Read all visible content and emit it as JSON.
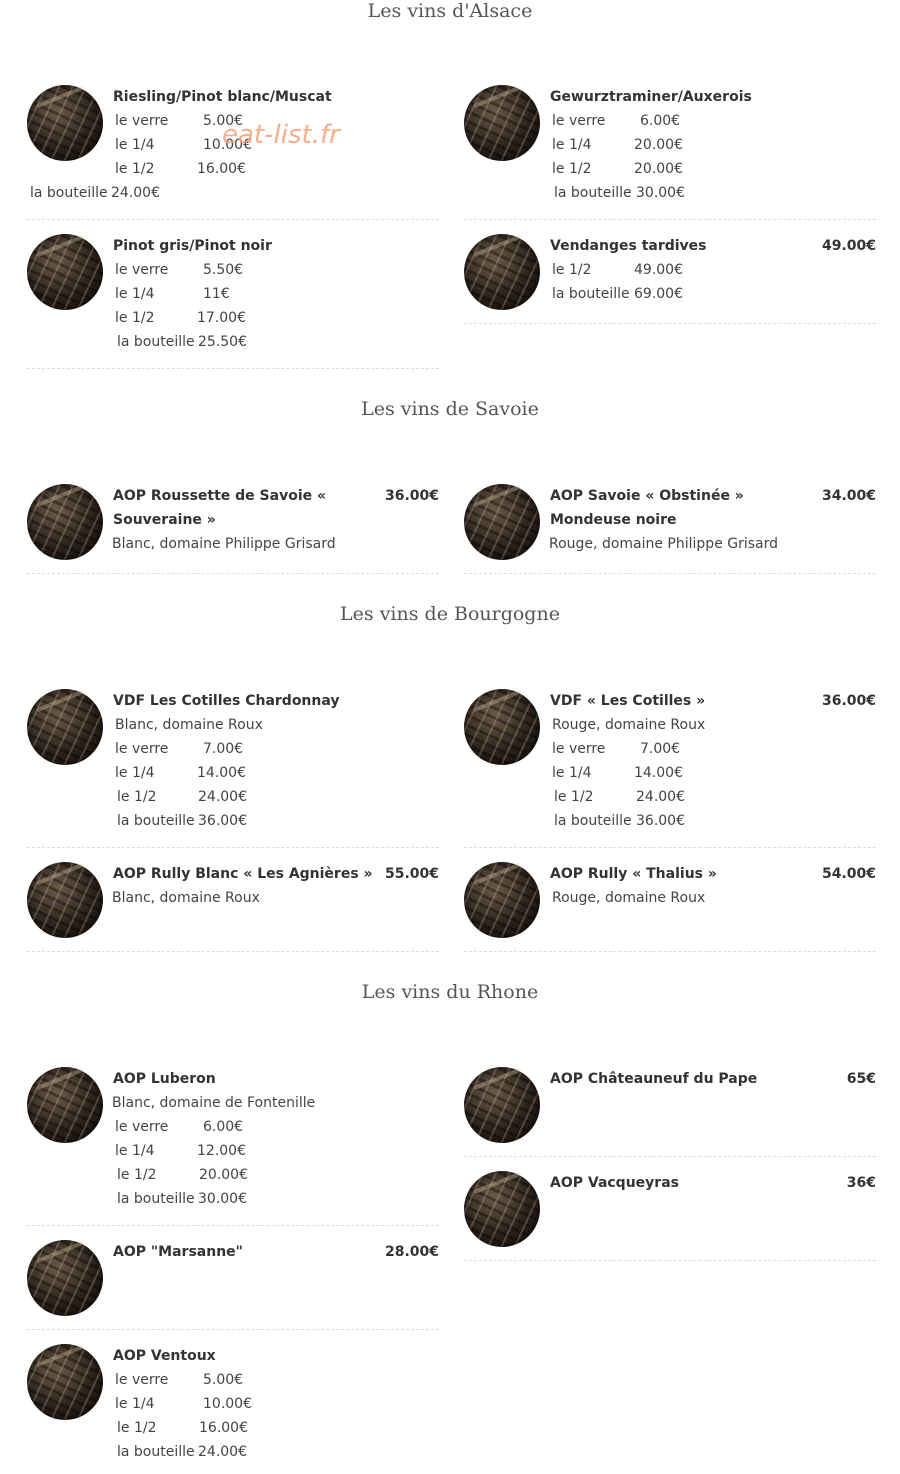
{
  "watermark": "eat-list.fr",
  "sections": [
    {
      "title": "Les vins d'Alsace"
    },
    {
      "title": "Les vins de Savoie"
    },
    {
      "title": "Les vins de Bourgogne"
    },
    {
      "title": "Les vins du Rhone"
    }
  ],
  "items": {
    "riesling": {
      "name": "Riesling/Pinot blanc/Muscat",
      "rows": [
        [
          "le verre",
          "5.00€"
        ],
        [
          "le 1/4",
          "10.00€"
        ],
        [
          "le 1/2",
          "16.00€"
        ],
        [
          "la bouteille",
          "24.00€"
        ]
      ]
    },
    "gewurz": {
      "name": "Gewurztraminer/Auxerois",
      "rows": [
        [
          "le verre",
          "6.00€"
        ],
        [
          "le 1/4",
          "20.00€"
        ],
        [
          "le 1/2",
          "20.00€"
        ],
        [
          "la bouteille",
          "30.00€"
        ]
      ]
    },
    "pinotgris": {
      "name": "Pinot gris/Pinot noir",
      "rows": [
        [
          "le verre",
          "5.50€"
        ],
        [
          "le 1/4",
          "11€"
        ],
        [
          "le 1/2",
          "17.00€"
        ],
        [
          "la bouteille",
          "25.50€"
        ]
      ]
    },
    "vendanges": {
      "name": "Vendanges tardives",
      "price": "49.00€",
      "rows": [
        [
          "le 1/2",
          "49.00€"
        ],
        [
          "la bouteille",
          "69.00€"
        ]
      ]
    },
    "roussette": {
      "name1": "AOP Roussette de Savoie «",
      "name2": "Souveraine »",
      "price": "36.00€",
      "desc": "Blanc, domaine Philippe Grisard"
    },
    "obstinee": {
      "name1": "AOP Savoie « Obstinée »",
      "name2": "Mondeuse noire",
      "price": "34.00€",
      "desc": "Rouge, domaine Philippe Grisard"
    },
    "cotilles_chard": {
      "name": "VDF Les Cotilles Chardonnay",
      "desc": "Blanc, domaine Roux",
      "rows": [
        [
          "le verre",
          "7.00€"
        ],
        [
          "le 1/4",
          "14.00€"
        ],
        [
          "le 1/2",
          "24.00€"
        ],
        [
          "la bouteille",
          "36.00€"
        ]
      ]
    },
    "cotilles": {
      "name": "VDF « Les Cotilles »",
      "price": "36.00€",
      "desc": "Rouge, domaine Roux",
      "rows": [
        [
          "le verre",
          "7.00€"
        ],
        [
          "le 1/4",
          "14.00€"
        ],
        [
          "le 1/2",
          "24.00€"
        ],
        [
          "la bouteille",
          "36.00€"
        ]
      ]
    },
    "rully_blanc": {
      "name": "AOP Rully Blanc « Les Agnières »",
      "price": "55.00€",
      "desc": "Blanc, domaine Roux"
    },
    "rully_thalius": {
      "name": "AOP Rully « Thalius »",
      "price": "54.00€",
      "desc": "Rouge, domaine Roux"
    },
    "luberon": {
      "name": "AOP Luberon",
      "desc": "Blanc, domaine de Fontenille",
      "rows": [
        [
          "le verre",
          "6.00€"
        ],
        [
          "le 1/4",
          "12.00€"
        ],
        [
          "le 1/2",
          "20.00€"
        ],
        [
          "la bouteille",
          "30.00€"
        ]
      ]
    },
    "chateauneuf": {
      "name": "AOP Châteauneuf du Pape",
      "price": "65€"
    },
    "vacqueyras": {
      "name": "AOP Vacqueyras",
      "price": "36€"
    },
    "marsanne": {
      "name": "AOP \"Marsanne\"",
      "price": "28.00€"
    },
    "ventoux": {
      "name": "AOP Ventoux",
      "rows": [
        [
          "le verre",
          "5.00€"
        ],
        [
          "le 1/4",
          "10.00€"
        ],
        [
          "le 1/2",
          "16.00€"
        ],
        [
          "la bouteille",
          "24.00€"
        ]
      ]
    }
  }
}
